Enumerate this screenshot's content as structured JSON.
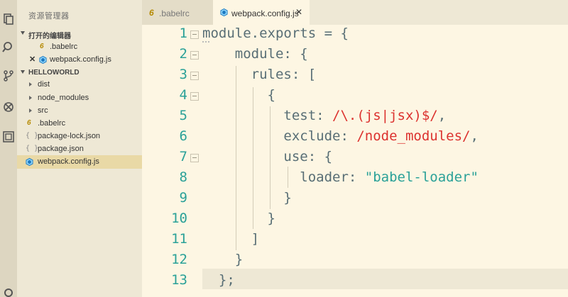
{
  "explorer": {
    "title": "资源管理器",
    "open_editors_label": "打开的编辑器",
    "open_editors": [
      {
        "name": ".babelrc",
        "icon": "babel-icon"
      },
      {
        "name": "webpack.config.js",
        "icon": "webpack-icon"
      }
    ],
    "project_label": "HELLOWORLD",
    "files": [
      {
        "name": "dist",
        "kind": "folder"
      },
      {
        "name": "node_modules",
        "kind": "folder"
      },
      {
        "name": "src",
        "kind": "folder"
      },
      {
        "name": ".babelrc",
        "kind": "babel"
      },
      {
        "name": "package-lock.json",
        "kind": "json"
      },
      {
        "name": "package.json",
        "kind": "json"
      },
      {
        "name": "webpack.config.js",
        "kind": "webpack",
        "active": true
      }
    ]
  },
  "tabs": [
    {
      "label": ".babelrc",
      "active": false
    },
    {
      "label": "webpack.config.js",
      "active": true
    }
  ],
  "glyphs": {
    "six": "6",
    "braces": "{ }",
    "close": "✕"
  },
  "editor": {
    "line_numbers": [
      "1",
      "2",
      "3",
      "4",
      "5",
      "6",
      "7",
      "8",
      "9",
      "10",
      "11",
      "12",
      "13"
    ],
    "lines": [
      [
        {
          "t": "module",
          "c": "plain"
        },
        {
          "t": ".exports = {",
          "c": "op"
        }
      ],
      [
        {
          "t": "    module: {",
          "c": "plain"
        }
      ],
      [
        {
          "t": "      rules: [",
          "c": "plain"
        }
      ],
      [
        {
          "t": "        {",
          "c": "plain"
        }
      ],
      [
        {
          "t": "          test: ",
          "c": "plain"
        },
        {
          "t": "/\\.(js|jsx)$/",
          "c": "red"
        },
        {
          "t": ",",
          "c": "plain"
        }
      ],
      [
        {
          "t": "          exclude: ",
          "c": "plain"
        },
        {
          "t": "/node_modules/",
          "c": "red"
        },
        {
          "t": ",",
          "c": "plain"
        }
      ],
      [
        {
          "t": "          use: {",
          "c": "plain"
        }
      ],
      [
        {
          "t": "            loader: ",
          "c": "plain"
        },
        {
          "t": "\"babel-loader\"",
          "c": "green"
        }
      ],
      [
        {
          "t": "          }",
          "c": "plain"
        }
      ],
      [
        {
          "t": "        }",
          "c": "plain"
        }
      ],
      [
        {
          "t": "      ]",
          "c": "plain"
        }
      ],
      [
        {
          "t": "    }",
          "c": "plain"
        }
      ],
      [
        {
          "t": "  };",
          "c": "plain"
        }
      ]
    ]
  },
  "colors": {
    "accent": "#2aa198",
    "regex": "#dc322f",
    "background": "#fdf6e3"
  }
}
